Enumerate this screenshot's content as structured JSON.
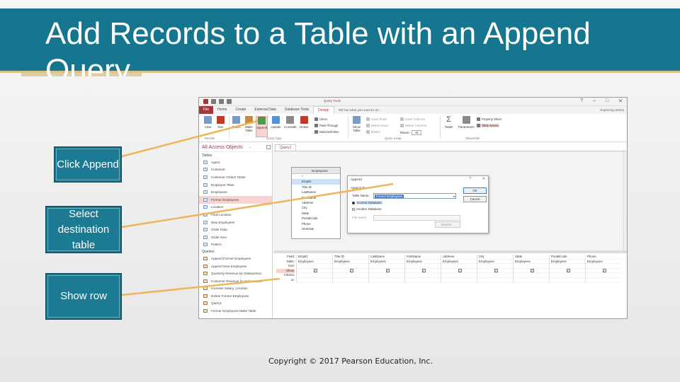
{
  "slide": {
    "title": "Add Records to a Table with an Append Query",
    "copyright": "Copyright © 2017 Pearson Education, Inc."
  },
  "callouts": {
    "append": "Click Append",
    "destination": "Select destination table",
    "show_row": "Show row"
  },
  "colors": {
    "banner": "#17768f",
    "callout": "#1a7187",
    "accent": "#a4373a",
    "connector": "#f0b45a"
  },
  "app": {
    "tool_tab": "Query Tools",
    "window_controls": [
      "?",
      "–",
      "□",
      "✕"
    ],
    "signin": "Exploring Series",
    "tellme": "Tell me what you want to do...",
    "tabs": [
      "File",
      "Home",
      "Create",
      "External Data",
      "Database Tools",
      "Design"
    ],
    "active_tab": "Design",
    "ribbon": {
      "results": [
        {
          "label": "View",
          "icon": "view-icon"
        },
        {
          "label": "Run",
          "icon": "run-icon"
        }
      ],
      "query_types": [
        {
          "label": "Select",
          "icon": "select-query-icon"
        },
        {
          "label": "Make Table",
          "icon": "make-table-icon"
        },
        {
          "label": "Append",
          "icon": "append-query-icon"
        },
        {
          "label": "Update",
          "icon": "update-query-icon"
        },
        {
          "label": "Crosstab",
          "icon": "crosstab-icon"
        },
        {
          "label": "Delete",
          "icon": "delete-query-icon"
        }
      ],
      "query_type_small": [
        "Union",
        "Pass-Through",
        "Data Definition"
      ],
      "show_table": "Show Table",
      "setup": [
        "Insert Rows",
        "Delete Rows",
        "Builder"
      ],
      "setup_cols": [
        "Insert Columns",
        "Delete Columns"
      ],
      "return_label": "Return:",
      "return_value": "All",
      "totals": "Totals",
      "parameters": "Parameters",
      "showhide": [
        "Property Sheet",
        "Table Names"
      ],
      "groups": [
        "Results",
        "Query Type",
        "Query Setup",
        "Show/Hide"
      ]
    },
    "nav": {
      "header": "All Access Objects",
      "tables_section": "Tables",
      "tables": [
        "Agent",
        "Customer",
        "Customer Orders Totals",
        "Employee Titles",
        "Employees",
        "Former Employees",
        "Location",
        "Final Location",
        "New Employees",
        "Order Data",
        "Order Item",
        "Pattern"
      ],
      "selected_table": "Former Employees",
      "queries_section": "Queries",
      "queries": [
        "Append Former Employees",
        "Append New Employees",
        "Quarterly Revenue by Salesperson",
        "Customer Revenue by Salesperson",
        "Increase Salary_Location",
        "Delete Former Employees",
        "Query1",
        "Former Employees Make Table"
      ]
    },
    "query": {
      "tab": "Query1",
      "table_name": "Employees",
      "fields": [
        "*",
        "EmpID",
        "Title ID",
        "LastName",
        "FirstName",
        "Address",
        "City",
        "State",
        "PostalCode",
        "Phone",
        "HireDate"
      ],
      "key_field": "EmpID"
    },
    "dialog": {
      "title": "Append",
      "help": "?",
      "close": "✕",
      "append_to": "Append To",
      "table_name_label": "Table Name:",
      "table_name_value": "Former Employees",
      "current_db": "Current Database",
      "another_db": "Another Database:",
      "file_name_label": "File Name:",
      "ok": "OK",
      "cancel": "Cancel",
      "browse": "Browse..."
    },
    "grid": {
      "row_labels": [
        "Field:",
        "Table:",
        "Sort:",
        "Show:",
        "Criteria:",
        "or:"
      ],
      "highlight_row": "Show:",
      "columns": [
        {
          "field": "EmpID",
          "table": "Employees"
        },
        {
          "field": "Title ID",
          "table": "Employees"
        },
        {
          "field": "LastName",
          "table": "Employees"
        },
        {
          "field": "FirstName",
          "table": "Employees"
        },
        {
          "field": "Address",
          "table": "Employees"
        },
        {
          "field": "City",
          "table": "Employees"
        },
        {
          "field": "State",
          "table": "Employees"
        },
        {
          "field": "PostalCode",
          "table": "Employees"
        },
        {
          "field": "Phone",
          "table": "Employees"
        }
      ]
    }
  }
}
